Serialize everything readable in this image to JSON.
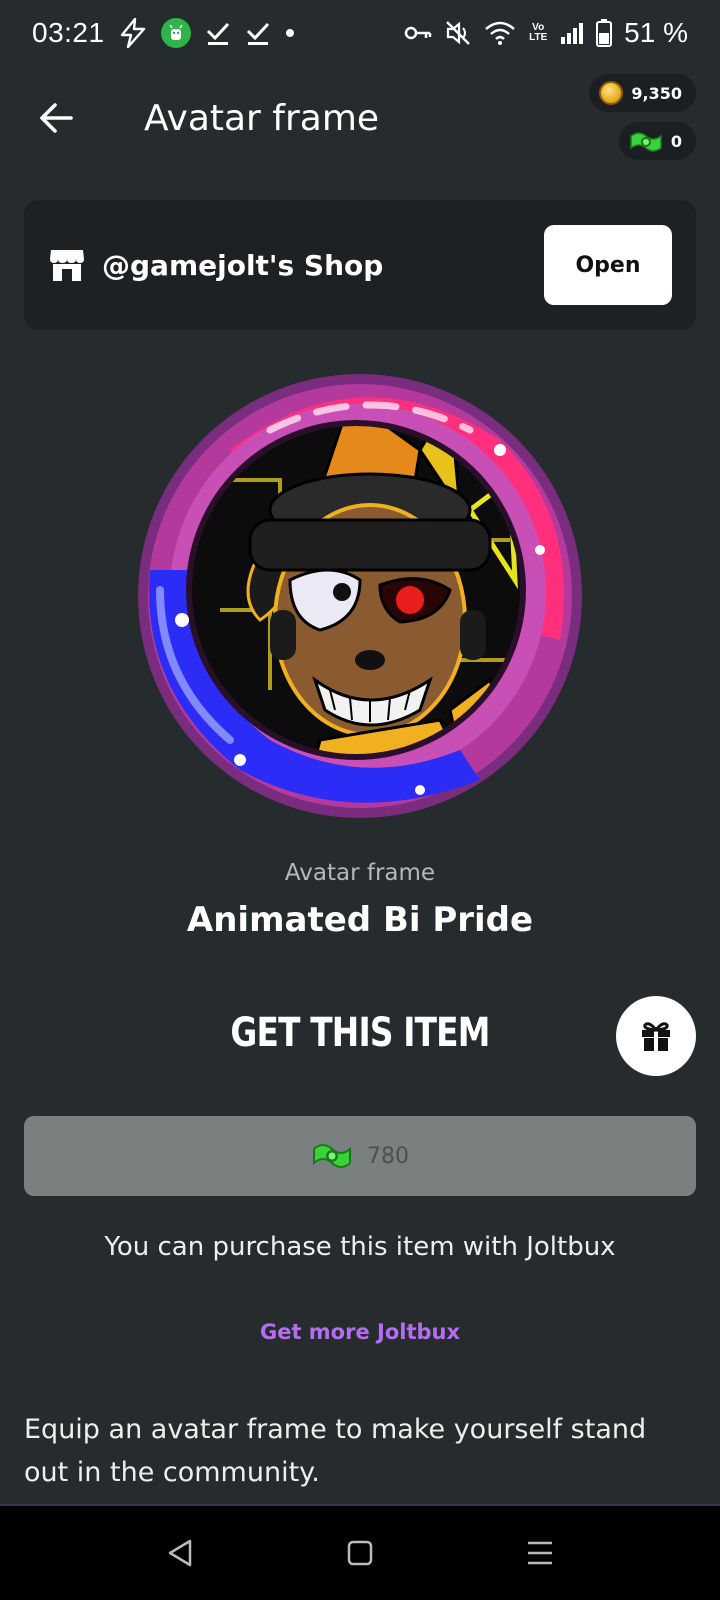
{
  "status_bar": {
    "time": "03:21",
    "battery": "51 %",
    "icons_left": [
      "bolt-icon",
      "app-notification-icon",
      "check-icon",
      "check-icon",
      "dot-icon"
    ],
    "icons_right": [
      "key-icon",
      "mute-icon",
      "wifi-icon",
      "volte-icon",
      "signal-icon",
      "battery-icon"
    ],
    "volte_label": "Vo LTE"
  },
  "header": {
    "title": "Avatar frame",
    "coins": "9,350",
    "joltbux": "0"
  },
  "shop": {
    "name": "@gamejolt's Shop",
    "open_label": "Open"
  },
  "item": {
    "type": "Avatar frame",
    "name": "Animated Bi Pride"
  },
  "purchase": {
    "title": "GET THIS ITEM",
    "price": "780",
    "note": "You can purchase this item with Joltbux",
    "more_link": "Get more Joltbux",
    "description": "Equip an avatar frame to make yourself stand out in the community."
  },
  "colors": {
    "background": "#262b2d",
    "link": "#b56cf0",
    "price_button": "#7a807f"
  }
}
